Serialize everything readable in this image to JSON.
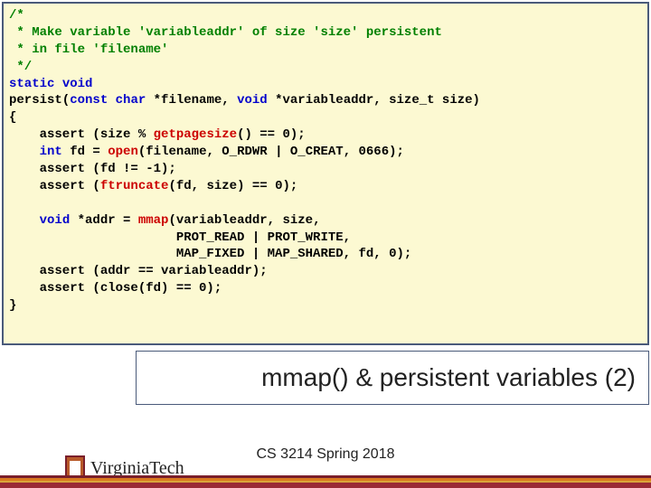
{
  "code": {
    "c1": "/*",
    "c2": " * Make variable 'variableaddr' of size 'size' persistent",
    "c3": " * in file 'filename'",
    "c4": " */",
    "l1a": "static",
    "l1b": " ",
    "l1c": "void",
    "l2a": "persist(",
    "l2b": "const",
    "l2c": " ",
    "l2d": "char",
    "l2e": " *filename, ",
    "l2f": "void",
    "l2g": " *variableaddr, size_t size)",
    "l3": "{",
    "l4a": "    assert (size % ",
    "l4b": "getpagesize",
    "l4c": "() == 0);",
    "l5a": "    ",
    "l5b": "int",
    "l5c": " fd = ",
    "l5d": "open",
    "l5e": "(filename, O_RDWR | O_CREAT, 0666);",
    "l6": "    assert (fd != -1);",
    "l7a": "    assert (",
    "l7b": "ftruncate",
    "l7c": "(fd, size) == 0);",
    "blank": "",
    "l8a": "    ",
    "l8b": "void",
    "l8c": " *addr = ",
    "l8d": "mmap",
    "l8e": "(variableaddr, size,",
    "l9": "                      PROT_READ | PROT_WRITE,",
    "l10": "                      MAP_FIXED | MAP_SHARED, fd, 0);",
    "l11": "    assert (addr == variableaddr);",
    "l12": "    assert (close(fd) == 0);",
    "l13": "}"
  },
  "title": "mmap() & persistent variables (2)",
  "footer": "CS 3214 Spring 2018",
  "logo": {
    "part1": "Vir",
    "part2": "g",
    "part3": "inia",
    "part4": "Tech"
  }
}
